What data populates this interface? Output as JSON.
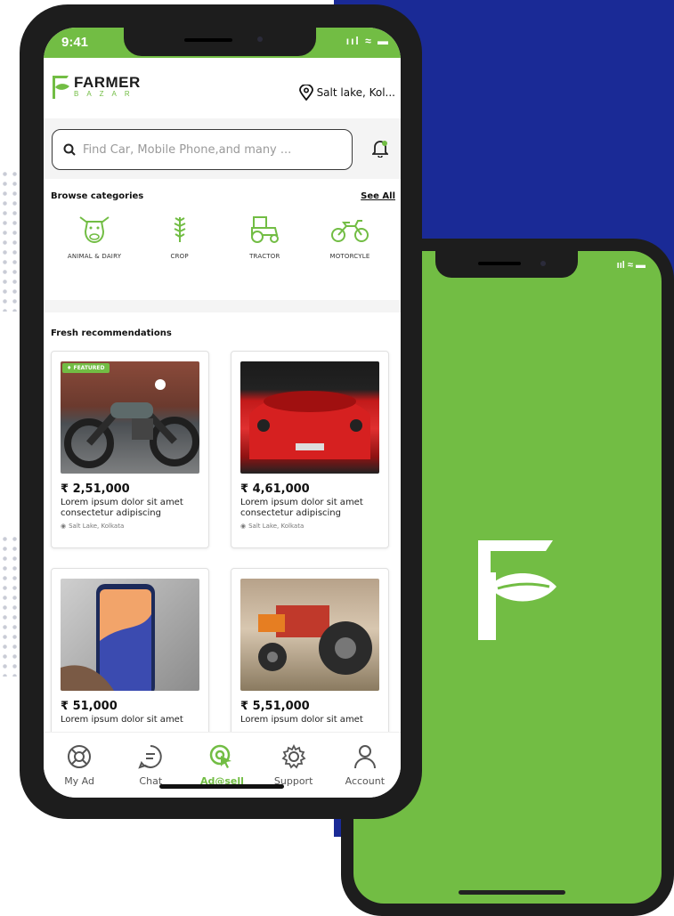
{
  "colors": {
    "brand_green": "#72bd44",
    "backdrop_blue": "#1a2a96",
    "frame": "#1d1d1d"
  },
  "status_bar": {
    "time": "9:41",
    "signal_icons": "signal wifi battery"
  },
  "brand": {
    "name_top": "FARMER",
    "name_bottom": "BAZAR"
  },
  "location": {
    "text": "Salt lake, Kol..."
  },
  "search": {
    "placeholder": "Find Car, Mobile Phone,and many ..."
  },
  "categories": {
    "heading": "Browse categories",
    "see_all": "See All",
    "items": [
      {
        "label": "ANIMAL & DAIRY",
        "icon": "cow-icon"
      },
      {
        "label": "CROP",
        "icon": "wheat-icon"
      },
      {
        "label": "TRACTOR",
        "icon": "tractor-icon"
      },
      {
        "label": "MOTORCYLE",
        "icon": "motorcycle-icon"
      }
    ]
  },
  "recommendations": {
    "heading": "Fresh recommendations",
    "featured_badge": "FEATURED",
    "items": [
      {
        "price": "₹ 2,51,000",
        "desc": "Lorem ipsum dolor sit amet consectetur adipiscing",
        "place": "Salt Lake, Kolkata",
        "image": "motorcycle-photo"
      },
      {
        "price": "₹ 4,61,000",
        "desc": "Lorem ipsum dolor sit amet consectetur adipiscing",
        "place": "Salt Lake, Kolkata",
        "image": "red-car-photo"
      },
      {
        "price": "₹ 51,000",
        "desc": "Lorem ipsum dolor sit amet",
        "place": "",
        "image": "phone-photo"
      },
      {
        "price": "₹ 5,51,000",
        "desc": "Lorem ipsum dolor sit amet",
        "place": "",
        "image": "tractor-photo"
      }
    ]
  },
  "tabs": [
    {
      "label": "My Ad",
      "icon": "lifebuoy-icon"
    },
    {
      "label": "Chat",
      "icon": "chat-icon"
    },
    {
      "label": "Ad@sell",
      "icon": "click-icon"
    },
    {
      "label": "Support",
      "icon": "gear-icon"
    },
    {
      "label": "Account",
      "icon": "user-icon"
    }
  ]
}
